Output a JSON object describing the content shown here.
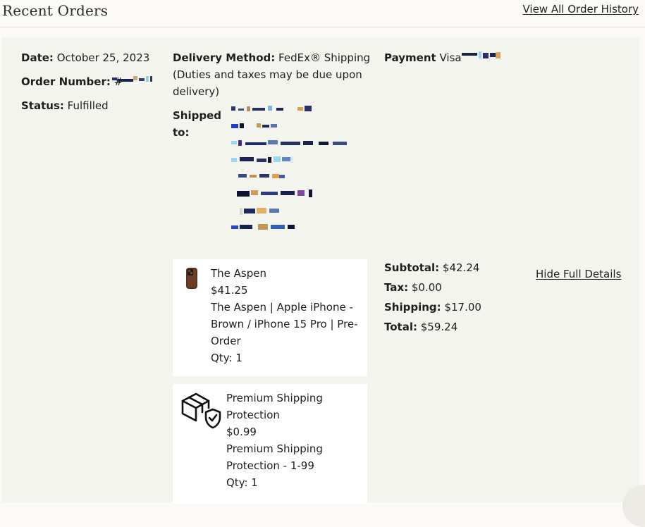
{
  "header": {
    "title": "Recent Orders",
    "view_all_link": "View All Order History"
  },
  "order": {
    "date_label": "Date:",
    "date_value": "October 25, 2023",
    "order_number_label": "Order Number:",
    "order_number_prefix": "#",
    "status_label": "Status:",
    "status_value": "Fulfilled",
    "delivery_label": "Delivery Method:",
    "delivery_value": "FedEx® Shipping",
    "delivery_note_1": "(Duties and taxes may be due upon",
    "delivery_note_2": "delivery)",
    "shipped_to_label_1": "Shipped",
    "shipped_to_label_2": "to:",
    "payment_label": "Payment",
    "payment_value": "Visa"
  },
  "items": [
    {
      "name": "The Aspen",
      "price": "$41.25",
      "desc_lines": [
        "The Aspen | Apple iPhone -",
        "Brown / iPhone 15 Pro | Pre-",
        "Order"
      ],
      "qty": "Qty: 1",
      "icon": "phone-case-thumbnail"
    },
    {
      "name_lines": [
        "Premium Shipping",
        "Protection"
      ],
      "price": "$0.99",
      "desc_lines": [
        "Premium Shipping",
        "Protection - 1-99"
      ],
      "qty": "Qty: 1",
      "icon": "package-shield-icon"
    }
  ],
  "totals": {
    "subtotal_label": "Subtotal:",
    "subtotal_value": "$42.24",
    "tax_label": "Tax:",
    "tax_value": "$0.00",
    "shipping_label": "Shipping:",
    "shipping_value": "$17.00",
    "total_label": "Total:",
    "total_value": "$59.24"
  },
  "actions": {
    "hide_details": "Hide Full Details"
  }
}
